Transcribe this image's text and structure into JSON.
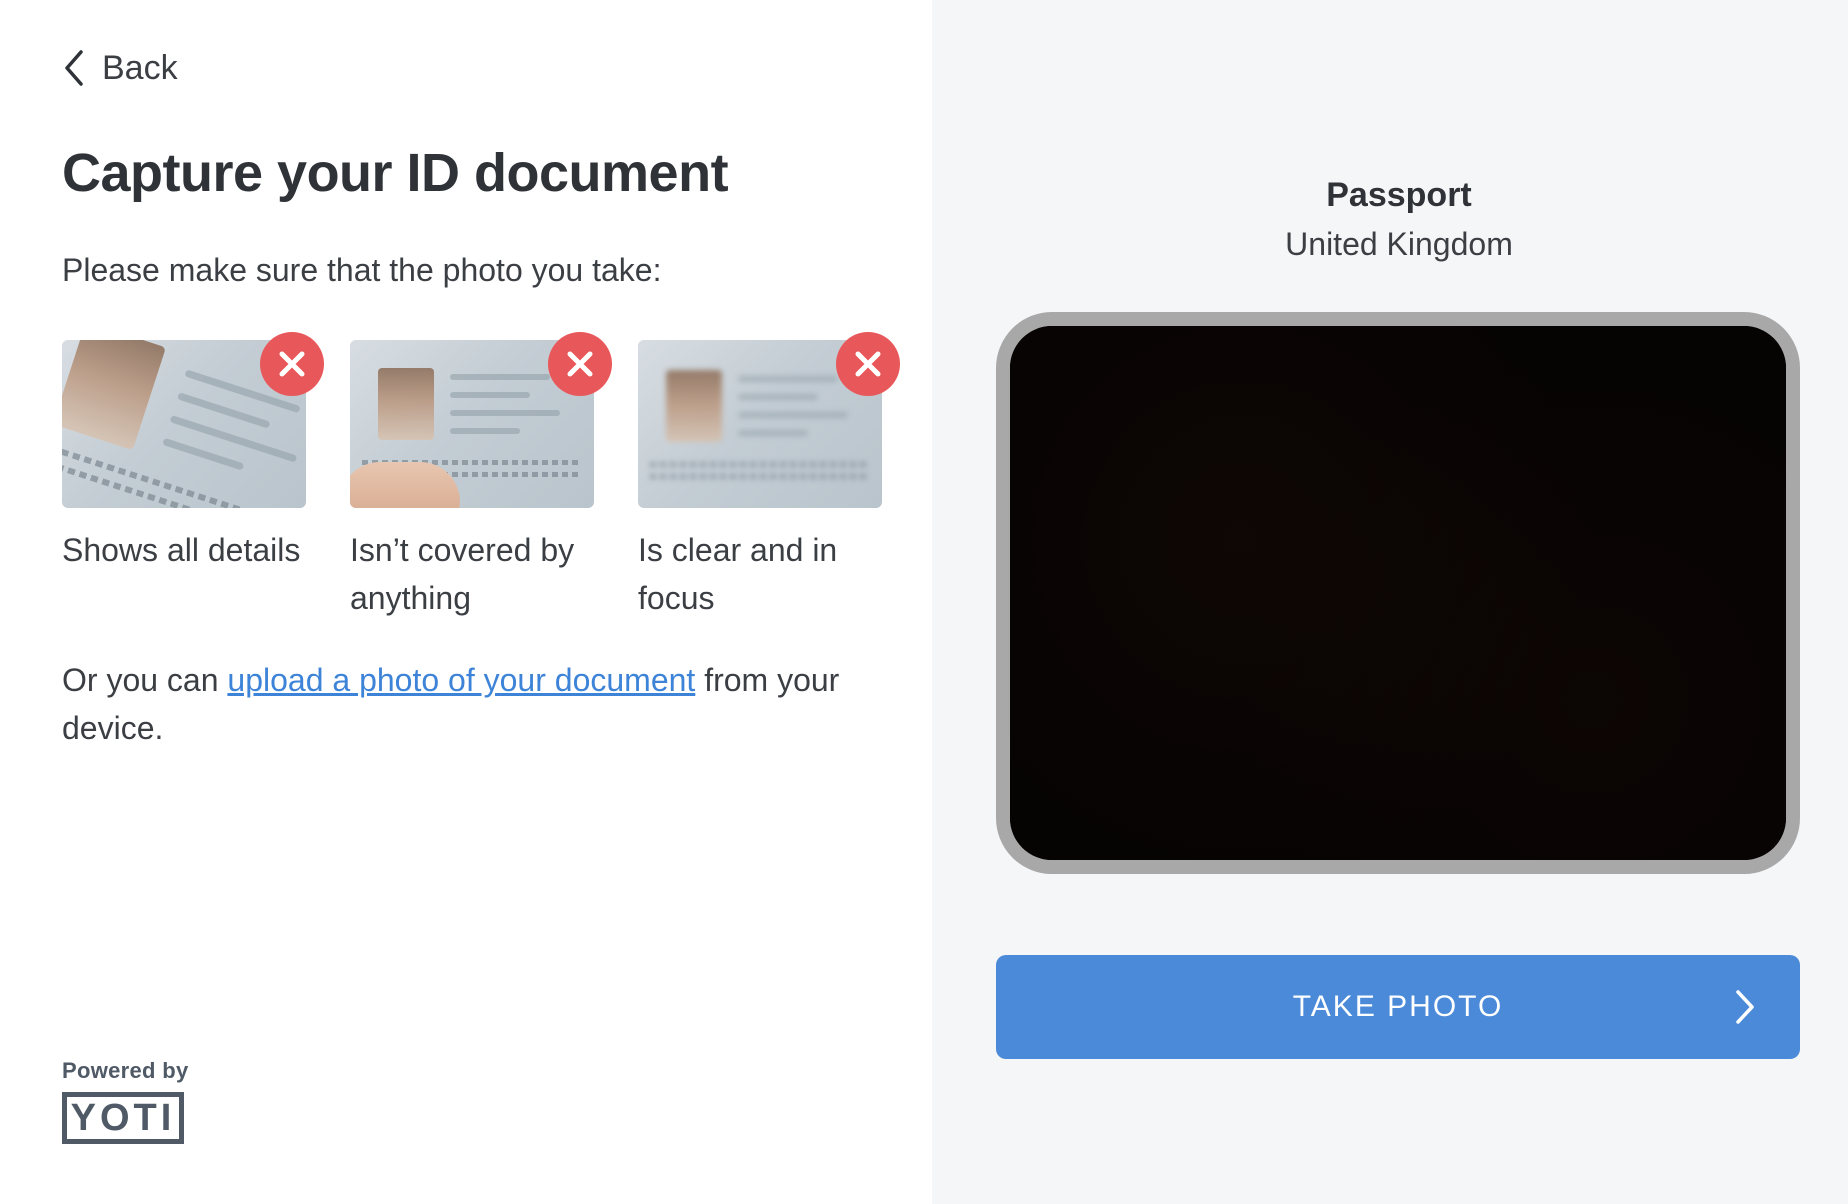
{
  "nav": {
    "back_label": "Back"
  },
  "main": {
    "title": "Capture your ID document",
    "intro": "Please make sure that the photo you take:",
    "tips": [
      {
        "caption": "Shows all details",
        "status": "invalid"
      },
      {
        "caption": "Isn’t covered by anything",
        "status": "invalid"
      },
      {
        "caption": "Is clear and in focus",
        "status": "invalid"
      }
    ],
    "upload_prefix": "Or you can ",
    "upload_link": "upload a photo of your document",
    "upload_suffix": " from your device."
  },
  "footer": {
    "powered_by": "Powered by",
    "brand": "YOTI"
  },
  "document": {
    "type": "Passport",
    "country": "United Kingdom"
  },
  "actions": {
    "take_photo": "TAKE PHOTO"
  },
  "colors": {
    "accent": "#4a8ad9",
    "link": "#3d84d8",
    "error": "#e8585a",
    "right_panel_bg": "#f5f6f8",
    "frame_border": "#a8a8a8"
  },
  "icons": {
    "back": "chevron-left-icon",
    "tip_status": "close-circle-icon",
    "take_photo": "chevron-right-icon"
  }
}
